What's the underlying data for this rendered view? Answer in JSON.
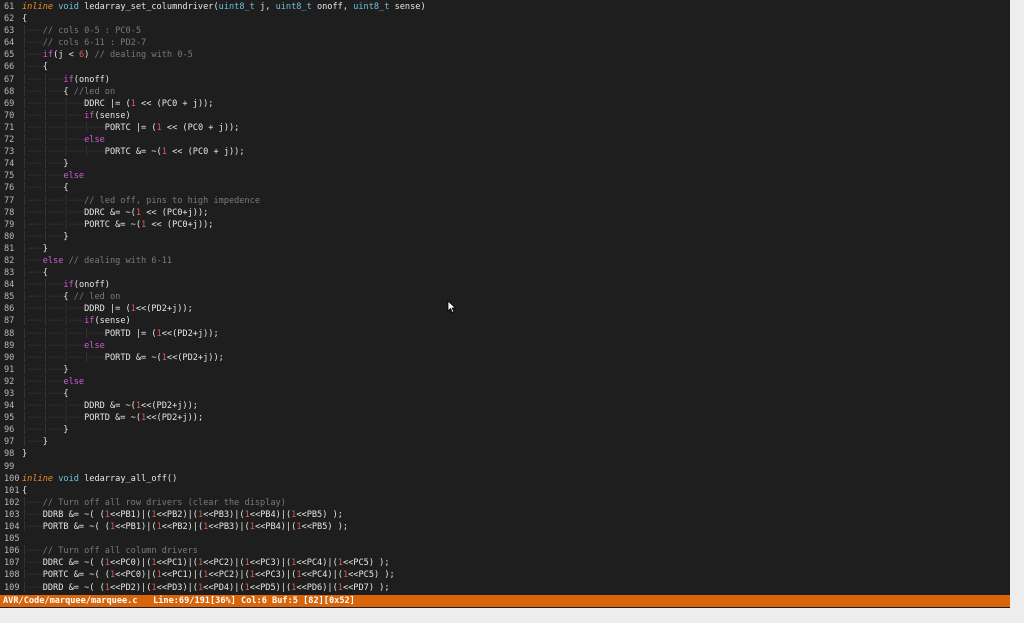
{
  "editor": {
    "lines": [
      {
        "n": "61",
        "t": [
          [
            "kw",
            "inline"
          ],
          [
            "p",
            " "
          ],
          [
            "type",
            "void"
          ],
          [
            "p",
            " ledarray_set_columndriver("
          ],
          [
            "type",
            "uint8_t"
          ],
          [
            "p",
            " j, "
          ],
          [
            "type",
            "uint8_t"
          ],
          [
            "p",
            " onoff, "
          ],
          [
            "type",
            "uint8_t"
          ],
          [
            "p",
            " sense)"
          ]
        ]
      },
      {
        "n": "62",
        "t": [
          [
            "p",
            "{"
          ]
        ]
      },
      {
        "n": "63",
        "t": [
          [
            "g",
            "    "
          ],
          [
            "cmt",
            "// cols 0-5 : PC0-5"
          ]
        ]
      },
      {
        "n": "64",
        "t": [
          [
            "g",
            "    "
          ],
          [
            "cmt",
            "// cols 6-11 : PD2-7"
          ]
        ]
      },
      {
        "n": "65",
        "t": [
          [
            "g",
            "    "
          ],
          [
            "ctl",
            "if"
          ],
          [
            "p",
            "(j < "
          ],
          [
            "num",
            "6"
          ],
          [
            "p",
            ") "
          ],
          [
            "cmt",
            "// dealing with 0-5"
          ]
        ]
      },
      {
        "n": "66",
        "t": [
          [
            "g",
            "    "
          ],
          [
            "p",
            "{"
          ]
        ]
      },
      {
        "n": "67",
        "t": [
          [
            "g",
            "        "
          ],
          [
            "ctl",
            "if"
          ],
          [
            "p",
            "(onoff)"
          ]
        ]
      },
      {
        "n": "68",
        "t": [
          [
            "g",
            "        "
          ],
          [
            "p",
            "{ "
          ],
          [
            "cmt",
            "//led on"
          ]
        ]
      },
      {
        "n": "69",
        "t": [
          [
            "g",
            "            "
          ],
          [
            "p",
            "DDRC |= ("
          ],
          [
            "num",
            "1"
          ],
          [
            "p",
            " << (PC0 + j));"
          ]
        ]
      },
      {
        "n": "70",
        "t": [
          [
            "g",
            "            "
          ],
          [
            "ctl",
            "if"
          ],
          [
            "p",
            "(sense)"
          ]
        ]
      },
      {
        "n": "71",
        "t": [
          [
            "g",
            "                "
          ],
          [
            "p",
            "PORTC |= ("
          ],
          [
            "num",
            "1"
          ],
          [
            "p",
            " << (PC0 + j));"
          ]
        ]
      },
      {
        "n": "72",
        "t": [
          [
            "g",
            "            "
          ],
          [
            "ctl",
            "else"
          ]
        ]
      },
      {
        "n": "73",
        "t": [
          [
            "g",
            "                "
          ],
          [
            "p",
            "PORTC &= ~("
          ],
          [
            "num",
            "1"
          ],
          [
            "p",
            " << (PC0 + j));"
          ]
        ]
      },
      {
        "n": "74",
        "t": [
          [
            "g",
            "        "
          ],
          [
            "p",
            "}"
          ]
        ]
      },
      {
        "n": "75",
        "t": [
          [
            "g",
            "        "
          ],
          [
            "ctl",
            "else"
          ]
        ]
      },
      {
        "n": "76",
        "t": [
          [
            "g",
            "        "
          ],
          [
            "p",
            "{"
          ]
        ]
      },
      {
        "n": "77",
        "t": [
          [
            "g",
            "            "
          ],
          [
            "cmt",
            "// led off, pins to high impedence"
          ]
        ]
      },
      {
        "n": "78",
        "t": [
          [
            "g",
            "            "
          ],
          [
            "p",
            "DDRC &= ~("
          ],
          [
            "num",
            "1"
          ],
          [
            "p",
            " << (PC0+j));"
          ]
        ]
      },
      {
        "n": "79",
        "t": [
          [
            "g",
            "            "
          ],
          [
            "p",
            "PORTC &= ~("
          ],
          [
            "num",
            "1"
          ],
          [
            "p",
            " << (PC0+j));"
          ]
        ]
      },
      {
        "n": "80",
        "t": [
          [
            "g",
            "        "
          ],
          [
            "p",
            "}"
          ]
        ]
      },
      {
        "n": "81",
        "t": [
          [
            "g",
            "    "
          ],
          [
            "p",
            "}"
          ]
        ]
      },
      {
        "n": "82",
        "t": [
          [
            "g",
            "    "
          ],
          [
            "ctl",
            "else"
          ],
          [
            "p",
            " "
          ],
          [
            "cmt",
            "// dealing with 6-11"
          ]
        ]
      },
      {
        "n": "83",
        "t": [
          [
            "g",
            "    "
          ],
          [
            "p",
            "{"
          ]
        ]
      },
      {
        "n": "84",
        "t": [
          [
            "g",
            "        "
          ],
          [
            "ctl",
            "if"
          ],
          [
            "p",
            "(onoff)"
          ]
        ]
      },
      {
        "n": "85",
        "t": [
          [
            "g",
            "        "
          ],
          [
            "p",
            "{ "
          ],
          [
            "cmt",
            "// led on"
          ]
        ]
      },
      {
        "n": "86",
        "t": [
          [
            "g",
            "            "
          ],
          [
            "p",
            "DDRD |= ("
          ],
          [
            "num",
            "1"
          ],
          [
            "p",
            "<<(PD2+j));"
          ]
        ]
      },
      {
        "n": "87",
        "t": [
          [
            "g",
            "            "
          ],
          [
            "ctl",
            "if"
          ],
          [
            "p",
            "(sense)"
          ]
        ]
      },
      {
        "n": "88",
        "t": [
          [
            "g",
            "                "
          ],
          [
            "p",
            "PORTD |= ("
          ],
          [
            "num",
            "1"
          ],
          [
            "p",
            "<<(PD2+j));"
          ]
        ]
      },
      {
        "n": "89",
        "t": [
          [
            "g",
            "            "
          ],
          [
            "ctl",
            "else"
          ]
        ]
      },
      {
        "n": "90",
        "t": [
          [
            "g",
            "                "
          ],
          [
            "p",
            "PORTD &= ~("
          ],
          [
            "num",
            "1"
          ],
          [
            "p",
            "<<(PD2+j));"
          ]
        ]
      },
      {
        "n": "91",
        "t": [
          [
            "g",
            "        "
          ],
          [
            "p",
            "}"
          ]
        ]
      },
      {
        "n": "92",
        "t": [
          [
            "g",
            "        "
          ],
          [
            "ctl",
            "else"
          ]
        ]
      },
      {
        "n": "93",
        "t": [
          [
            "g",
            "        "
          ],
          [
            "p",
            "{"
          ]
        ]
      },
      {
        "n": "94",
        "t": [
          [
            "g",
            "            "
          ],
          [
            "p",
            "DDRD &= ~("
          ],
          [
            "num",
            "1"
          ],
          [
            "p",
            "<<(PD2+j));"
          ]
        ]
      },
      {
        "n": "95",
        "t": [
          [
            "g",
            "            "
          ],
          [
            "p",
            "PORTD &= ~("
          ],
          [
            "num",
            "1"
          ],
          [
            "p",
            "<<(PD2+j));"
          ]
        ]
      },
      {
        "n": "96",
        "t": [
          [
            "g",
            "        "
          ],
          [
            "p",
            "}"
          ]
        ]
      },
      {
        "n": "97",
        "t": [
          [
            "g",
            "    "
          ],
          [
            "p",
            "}"
          ]
        ]
      },
      {
        "n": "98",
        "t": [
          [
            "p",
            "}"
          ]
        ]
      },
      {
        "n": "99",
        "t": []
      },
      {
        "n": "100",
        "t": [
          [
            "kw",
            "inline"
          ],
          [
            "p",
            " "
          ],
          [
            "type",
            "void"
          ],
          [
            "p",
            " ledarray_all_off()"
          ]
        ]
      },
      {
        "n": "101",
        "t": [
          [
            "p",
            "{"
          ]
        ]
      },
      {
        "n": "102",
        "t": [
          [
            "g",
            "    "
          ],
          [
            "cmt",
            "// Turn off all row drivers (clear the display)"
          ]
        ]
      },
      {
        "n": "103",
        "t": [
          [
            "g",
            "    "
          ],
          [
            "p",
            "DDRB &= ~( ("
          ],
          [
            "num",
            "1"
          ],
          [
            "p",
            "<<PB1)|("
          ],
          [
            "num",
            "1"
          ],
          [
            "p",
            "<<PB2)|("
          ],
          [
            "num",
            "1"
          ],
          [
            "p",
            "<<PB3)|("
          ],
          [
            "num",
            "1"
          ],
          [
            "p",
            "<<PB4)|("
          ],
          [
            "num",
            "1"
          ],
          [
            "p",
            "<<PB5) );"
          ]
        ]
      },
      {
        "n": "104",
        "t": [
          [
            "g",
            "    "
          ],
          [
            "p",
            "PORTB &= ~( ("
          ],
          [
            "num",
            "1"
          ],
          [
            "p",
            "<<PB1)|("
          ],
          [
            "num",
            "1"
          ],
          [
            "p",
            "<<PB2)|("
          ],
          [
            "num",
            "1"
          ],
          [
            "p",
            "<<PB3)|("
          ],
          [
            "num",
            "1"
          ],
          [
            "p",
            "<<PB4)|("
          ],
          [
            "num",
            "1"
          ],
          [
            "p",
            "<<PB5) );"
          ]
        ]
      },
      {
        "n": "105",
        "t": []
      },
      {
        "n": "106",
        "t": [
          [
            "g",
            "    "
          ],
          [
            "cmt",
            "// Turn off all column drivers"
          ]
        ]
      },
      {
        "n": "107",
        "t": [
          [
            "g",
            "    "
          ],
          [
            "p",
            "DDRC &= ~( ("
          ],
          [
            "num",
            "1"
          ],
          [
            "p",
            "<<PC0)|("
          ],
          [
            "num",
            "1"
          ],
          [
            "p",
            "<<PC1)|("
          ],
          [
            "num",
            "1"
          ],
          [
            "p",
            "<<PC2)|("
          ],
          [
            "num",
            "1"
          ],
          [
            "p",
            "<<PC3)|("
          ],
          [
            "num",
            "1"
          ],
          [
            "p",
            "<<PC4)|("
          ],
          [
            "num",
            "1"
          ],
          [
            "p",
            "<<PC5) );"
          ]
        ]
      },
      {
        "n": "108",
        "t": [
          [
            "g",
            "    "
          ],
          [
            "p",
            "PORTC &= ~( ("
          ],
          [
            "num",
            "1"
          ],
          [
            "p",
            "<<PC0)|("
          ],
          [
            "num",
            "1"
          ],
          [
            "p",
            "<<PC1)|("
          ],
          [
            "num",
            "1"
          ],
          [
            "p",
            "<<PC2)|("
          ],
          [
            "num",
            "1"
          ],
          [
            "p",
            "<<PC3)|("
          ],
          [
            "num",
            "1"
          ],
          [
            "p",
            "<<PC4)|("
          ],
          [
            "num",
            "1"
          ],
          [
            "p",
            "<<PC5) );"
          ]
        ]
      },
      {
        "n": "109",
        "t": [
          [
            "g",
            "    "
          ],
          [
            "p",
            "DDRD &= ~( ("
          ],
          [
            "num",
            "1"
          ],
          [
            "p",
            "<<PD2)|("
          ],
          [
            "num",
            "1"
          ],
          [
            "p",
            "<<PD3)|("
          ],
          [
            "num",
            "1"
          ],
          [
            "p",
            "<<PD4)|("
          ],
          [
            "num",
            "1"
          ],
          [
            "p",
            "<<PD5)|("
          ],
          [
            "num",
            "1"
          ],
          [
            "p",
            "<<PD6)|("
          ],
          [
            "num",
            "1"
          ],
          [
            "p",
            "<<PD7) );"
          ]
        ]
      }
    ]
  },
  "status": {
    "path": "AVR/Code/marquee/marquee.c",
    "info": "Line:69/191[36%] Col:6 Buf:5 [82][0x52]"
  },
  "colors": {
    "background": "#1e1e1e",
    "statusbar": "#d8650a",
    "keyword": "#f08a24",
    "type": "#6cc0d8",
    "control": "#d45bd8",
    "comment": "#7a7a7a",
    "number": "#e05a5a"
  },
  "icons": {
    "cursor": "mouse-pointer-icon"
  }
}
